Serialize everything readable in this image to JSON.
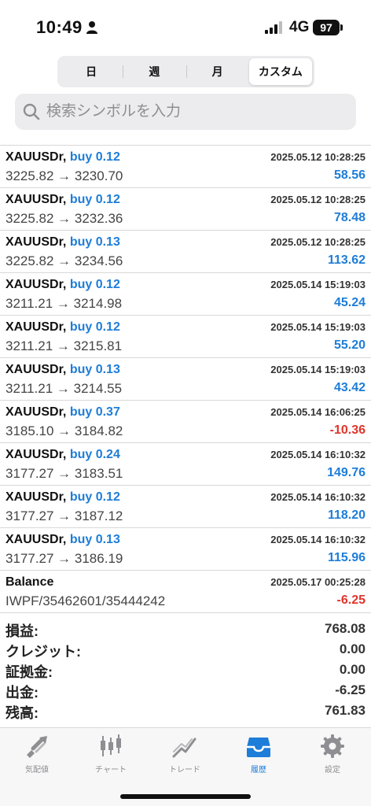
{
  "status_bar": {
    "time": "10:49",
    "network": "4G",
    "battery": "97"
  },
  "period_tabs": [
    {
      "label": "日",
      "active": false
    },
    {
      "label": "週",
      "active": false
    },
    {
      "label": "月",
      "active": false
    },
    {
      "label": "カスタム",
      "active": true
    }
  ],
  "search": {
    "placeholder": "検索シンボルを入力",
    "value": ""
  },
  "trades": [
    {
      "symbol": "XAUUSDr,",
      "side": "buy 0.12",
      "datetime": "2025.05.12 10:28:25",
      "prices": "3225.82 → 3230.70",
      "profit": "58.56",
      "sign": "pos"
    },
    {
      "symbol": "XAUUSDr,",
      "side": "buy 0.12",
      "datetime": "2025.05.12 10:28:25",
      "prices": "3225.82 → 3232.36",
      "profit": "78.48",
      "sign": "pos"
    },
    {
      "symbol": "XAUUSDr,",
      "side": "buy 0.13",
      "datetime": "2025.05.12 10:28:25",
      "prices": "3225.82 → 3234.56",
      "profit": "113.62",
      "sign": "pos"
    },
    {
      "symbol": "XAUUSDr,",
      "side": "buy 0.12",
      "datetime": "2025.05.14 15:19:03",
      "prices": "3211.21 → 3214.98",
      "profit": "45.24",
      "sign": "pos"
    },
    {
      "symbol": "XAUUSDr,",
      "side": "buy 0.12",
      "datetime": "2025.05.14 15:19:03",
      "prices": "3211.21 → 3215.81",
      "profit": "55.20",
      "sign": "pos"
    },
    {
      "symbol": "XAUUSDr,",
      "side": "buy 0.13",
      "datetime": "2025.05.14 15:19:03",
      "prices": "3211.21 → 3214.55",
      "profit": "43.42",
      "sign": "pos"
    },
    {
      "symbol": "XAUUSDr,",
      "side": "buy 0.37",
      "datetime": "2025.05.14 16:06:25",
      "prices": "3185.10 → 3184.82",
      "profit": "-10.36",
      "sign": "neg"
    },
    {
      "symbol": "XAUUSDr,",
      "side": "buy 0.24",
      "datetime": "2025.05.14 16:10:32",
      "prices": "3177.27 → 3183.51",
      "profit": "149.76",
      "sign": "pos"
    },
    {
      "symbol": "XAUUSDr,",
      "side": "buy 0.12",
      "datetime": "2025.05.14 16:10:32",
      "prices": "3177.27 → 3187.12",
      "profit": "118.20",
      "sign": "pos"
    },
    {
      "symbol": "XAUUSDr,",
      "side": "buy 0.13",
      "datetime": "2025.05.14 16:10:32",
      "prices": "3177.27 → 3186.19",
      "profit": "115.96",
      "sign": "pos"
    }
  ],
  "balance_entry": {
    "label": "Balance",
    "datetime": "2025.05.17 00:25:28",
    "comment": "IWPF/35462601/35444242",
    "amount": "-6.25",
    "sign": "neg"
  },
  "summary": [
    {
      "label": "損益:",
      "value": "768.08"
    },
    {
      "label": "クレジット:",
      "value": "0.00"
    },
    {
      "label": "証拠金:",
      "value": "0.00"
    },
    {
      "label": "出金:",
      "value": "-6.25"
    },
    {
      "label": "残高:",
      "value": "761.83"
    }
  ],
  "tabbar": [
    {
      "label": "気配値",
      "icon": "quotes-icon",
      "active": false
    },
    {
      "label": "チャート",
      "icon": "chart-icon",
      "active": false
    },
    {
      "label": "トレード",
      "icon": "trade-icon",
      "active": false
    },
    {
      "label": "履歴",
      "icon": "history-icon",
      "active": true
    },
    {
      "label": "設定",
      "icon": "settings-icon",
      "active": false
    }
  ],
  "colors": {
    "accent": "#1e7dd8",
    "negative": "#e0352b",
    "inactive": "#8e8e93"
  }
}
